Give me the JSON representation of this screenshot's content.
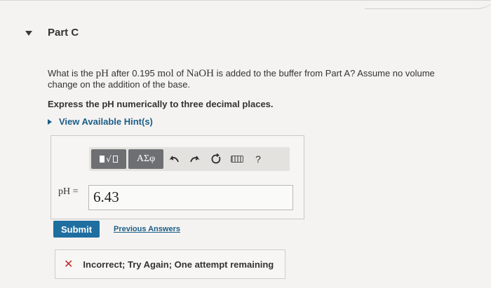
{
  "part": {
    "title": "Part C"
  },
  "question": {
    "text_1": "What is the ",
    "ph_symbol": "pH",
    "text_2": " after 0.195 ",
    "mol_unit": "mol",
    "text_3": " of ",
    "naoh": "NaOH",
    "text_4": " is added to the buffer from Part A? Assume no volume change on the addition of the base."
  },
  "instruction": "Express the pH numerically to three decimal places.",
  "hints": {
    "label": "View Available Hint(s)"
  },
  "toolbar": {
    "greek_label": "ΑΣφ",
    "undo_icon": "undo-icon",
    "redo_icon": "redo-icon",
    "reset_icon": "reset-icon",
    "keyboard_icon": "keyboard-icon",
    "help_label": "?"
  },
  "answer": {
    "label": "pH =",
    "value": "6.43"
  },
  "submit": {
    "label": "Submit"
  },
  "previous_answers": {
    "label": "Previous Answers"
  },
  "feedback": {
    "icon": "x-icon",
    "text": "Incorrect; Try Again; One attempt remaining",
    "color": "#c0282a"
  }
}
